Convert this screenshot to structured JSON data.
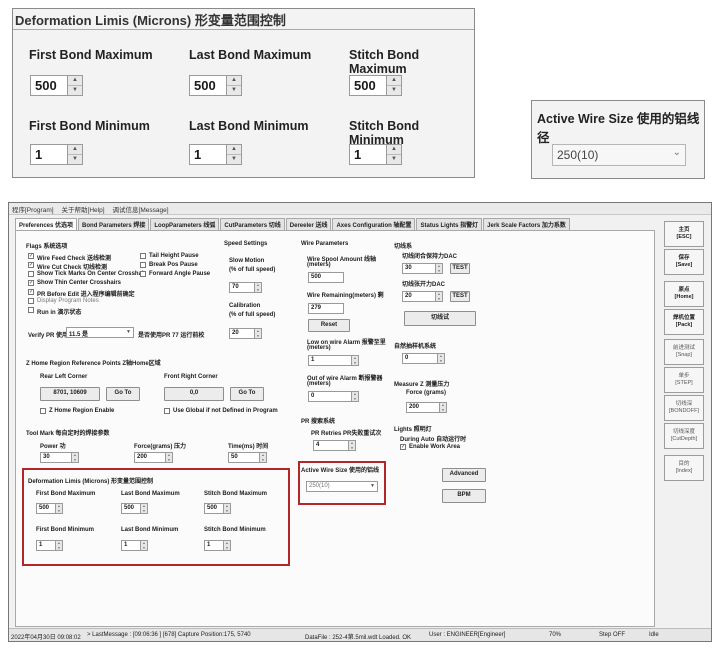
{
  "zoom": {
    "deformation": {
      "title": "Deformation Limis (Microns) 形变量范围控制",
      "first_bond_max_label": "First Bond Maximum",
      "last_bond_max_label": "Last Bond Maximum",
      "stitch_bond_max_label": "Stitch Bond Maximum",
      "first_bond_min_label": "First Bond Minimum",
      "last_bond_min_label": "Last Bond Minimum",
      "stitch_bond_min_label": "Stitch Bond Minimum",
      "first_bond_max": "500",
      "last_bond_max": "500",
      "stitch_bond_max": "500",
      "first_bond_min": "1",
      "last_bond_min": "1",
      "stitch_bond_min": "1"
    },
    "wire": {
      "title": "Active Wire Size 使用的铝线径",
      "value": "250(10)"
    }
  },
  "app": {
    "menu": [
      "程序[Program]",
      "关于帮助[Help]",
      "调试信息[Message]"
    ],
    "tabs": [
      "Preferences 优选项",
      "Bond Parameters 焊接",
      "LoopParameters 线弧",
      "CutParameters 切线",
      "Dereeler 送线",
      "Axes Configuration 轴配置",
      "Status Lights 指警灯",
      "Jerk Scale Factors 加力系数"
    ],
    "flags": {
      "title": "Flags 系统选项",
      "items": [
        {
          "label": "Wire Feed Check 送线检测",
          "checked": true
        },
        {
          "label": "Wire Cut Check 切线检测",
          "checked": true
        },
        {
          "label": "Show Tick Marks On Center Crosshair",
          "checked": false
        },
        {
          "label": "Show Thin Center Crosshairs",
          "checked": true
        },
        {
          "label": "PR Before Edit 进入程序编辑前确定",
          "checked": true
        },
        {
          "label": "Display Program Notes",
          "checked": false
        },
        {
          "label": "Run in 演示状态",
          "checked": false
        }
      ],
      "pause_items": [
        {
          "label": "Tail Height Pause",
          "checked": false
        },
        {
          "label": "Break Pos Pause",
          "checked": false
        },
        {
          "label": "Forward Angle Pause",
          "checked": false
        }
      ],
      "verify_pr_label": "Verify PR 使用",
      "verify_pr_value": "11.5 是",
      "pr77_label": "是否使用PR 77 运行前校"
    },
    "speed": {
      "title": "Speed Settings",
      "slow_motion_label": "Slow Motion",
      "slow_motion_unit": "(% of full speed)",
      "slow_motion_value": "70",
      "calibration_label": "Calibration",
      "calibration_unit": "(% of full speed)",
      "calibration_value": "20"
    },
    "wire_params": {
      "title": "Wire Parameters",
      "spool_label": "Wire Spool Amount 线轴",
      "spool_unit": "(meters)",
      "spool_value": "500",
      "remaining_label": "Wire Remaining(meters) 剩",
      "remaining_value": "279",
      "reset_label": "Reset",
      "low_alarm_label": "Low on wire Alarm 报警至里",
      "low_alarm_unit": "(meters)",
      "low_alarm_value": "1",
      "out_alarm_label": "Out of wire Alarm 断报警器",
      "out_alarm_unit": "(meters)",
      "out_alarm_value": "0"
    },
    "cut_wire": {
      "title": "切线系",
      "dac1_label": "切线闭合保持力DAC",
      "dac1_value": "30",
      "dac2_label": "切线张开力DAC",
      "dac2_value": "20",
      "test_label": "TEST",
      "cut_button": "切线试",
      "auto_label": "自然抽样机系统",
      "auto_value": "0"
    },
    "home": {
      "title": "Z Home Region Reference Points Z轴Home区域",
      "rear_left_label": "Rear Left Corner",
      "front_right_label": "Front Right Corner",
      "rear_left_value": "8701, 10609",
      "front_right_value": "0,0",
      "goto_label": "Go To",
      "enable_label": "Z Home Region Enable",
      "global_label": "Use Global if not Defined in Program"
    },
    "z_force": {
      "title": "Measure Z 测量压力",
      "force_label": "Force (grams)",
      "force_value": "200"
    },
    "tool_mark": {
      "title": "Tool Mark 每自定时的焊接参数",
      "power_label": "Power 功",
      "power_value": "30",
      "force_label": "Force(grams) 压力",
      "force_value": "200",
      "time_label": "Time(ms) 时间",
      "time_value": "50"
    },
    "pr": {
      "title": "PR 搜索系统",
      "retries_label": "PR Retries PR失败重试次",
      "retries_value": "4"
    },
    "lights": {
      "title": "Lights 照明灯",
      "during_label": "During Auto 自动运行时",
      "enable_label": "Enable Work Area"
    },
    "deform_small": {
      "title": "Deformation Limis (Microns) 形变量范围控制",
      "first_bond_max_label": "First Bond Maximum",
      "last_bond_max_label": "Last Bond Maximum",
      "stitch_bond_max_label": "Stitch Bond Maximum",
      "first_bond_min_label": "First Bond Minimum",
      "last_bond_min_label": "Last Bond Minimum",
      "stitch_bond_min_label": "Stitch Bond Minimum",
      "max_value": "500",
      "min_value": "1"
    },
    "active_wire": {
      "title": "Active Wire Size 使用的铝线",
      "value": "250(10)"
    },
    "advanced_label": "Advanced",
    "bpm_label": "BPM",
    "side": [
      {
        "label": "主页",
        "sub": "[ESC]",
        "bold": true
      },
      {
        "label": "保存",
        "sub": "[Save]",
        "bold": true
      },
      {
        "label": "原点",
        "sub": "[Home]",
        "bold": true
      },
      {
        "label": "焊机位置",
        "sub": "[Pack]",
        "bold": true
      },
      {
        "label": "前进测试",
        "sub": "[Snap]",
        "bold": false
      },
      {
        "label": "单步",
        "sub": "[STEP]",
        "bold": false
      },
      {
        "label": "切线深",
        "sub": "[BONDOFF]",
        "bold": false
      },
      {
        "label": "切线深度",
        "sub": "[CutDepth]",
        "bold": false
      },
      {
        "label": "目的",
        "sub": "[Index]",
        "bold": false
      }
    ],
    "status": {
      "time": "2022年04月30日 09:08:02",
      "message": "> LastMessage : [09:06:36 ] [678] Capture Position:175, 5740",
      "datafile": "DataFile : 252-4第.5mil.wdt Loaded. OK",
      "user": "User : ENGINEER[Engineer]",
      "zoom": "70%",
      "step": "Step OFF",
      "mode": "Idle"
    }
  }
}
